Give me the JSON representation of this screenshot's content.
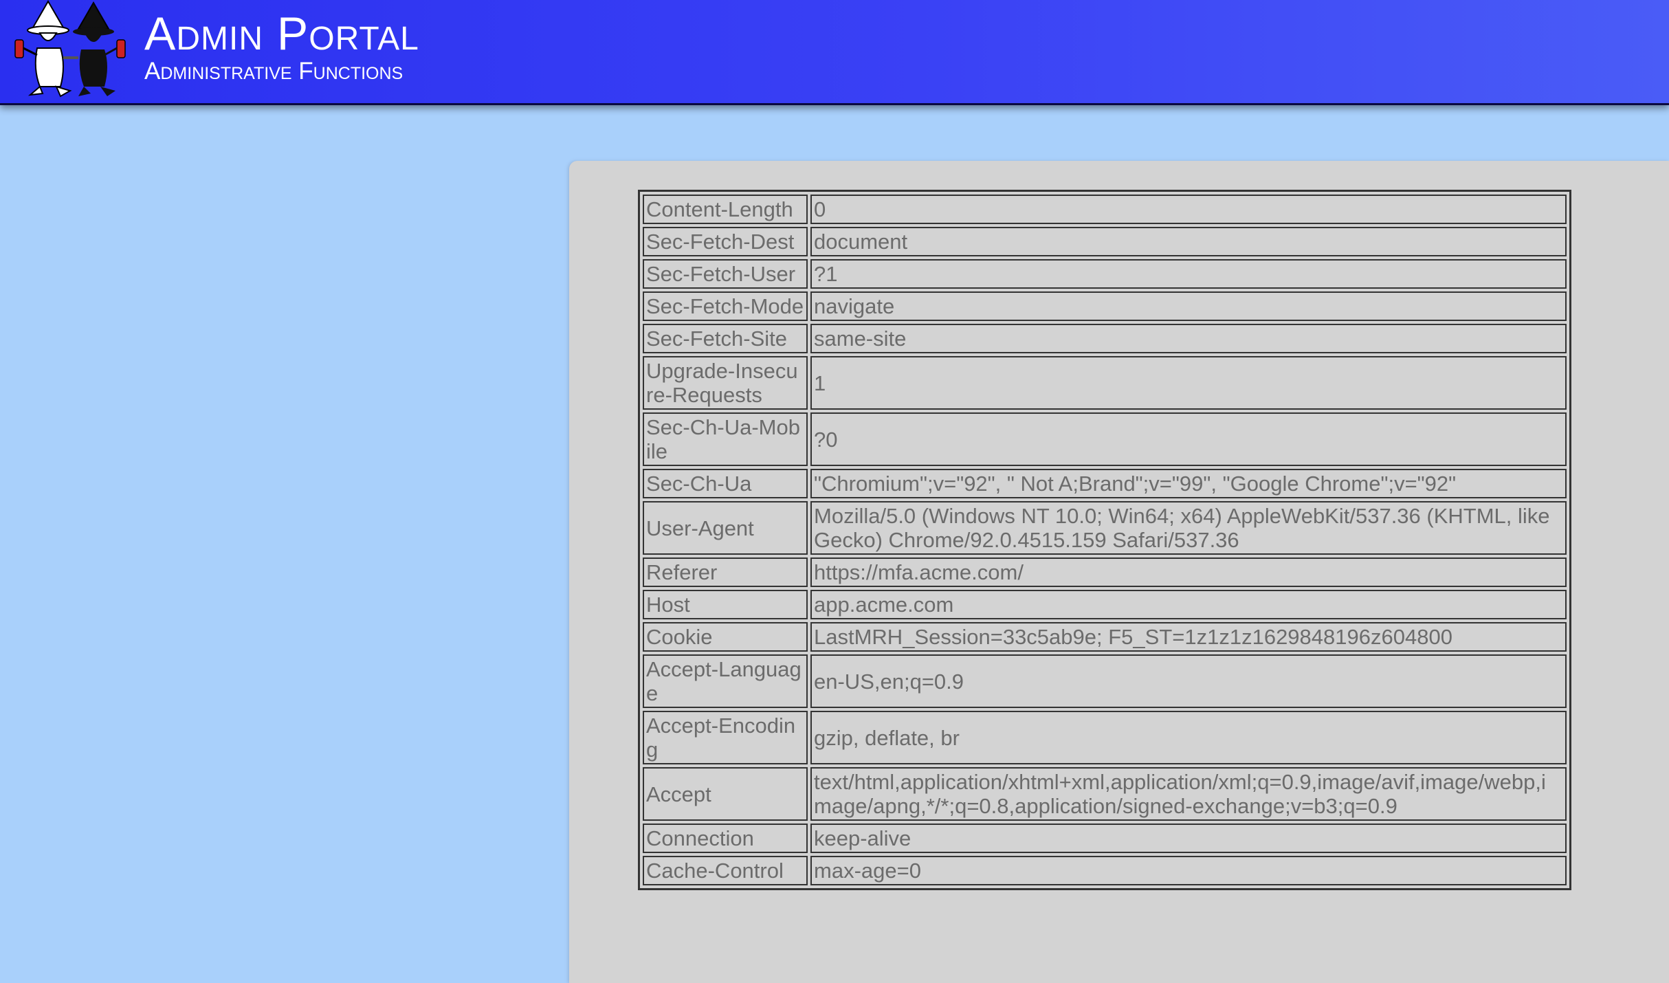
{
  "header": {
    "title": "Admin Portal",
    "subtitle": "Administrative Functions",
    "logo_icon": "spy-vs-spy-logo",
    "background_color": "#3439f3"
  },
  "headers_table": {
    "rows": [
      {
        "name": "Content-Length",
        "value": "0"
      },
      {
        "name": "Sec-Fetch-Dest",
        "value": "document"
      },
      {
        "name": "Sec-Fetch-User",
        "value": "?1"
      },
      {
        "name": "Sec-Fetch-Mode",
        "value": "navigate"
      },
      {
        "name": "Sec-Fetch-Site",
        "value": "same-site"
      },
      {
        "name": "Upgrade-Insecure-Requests",
        "value": "1"
      },
      {
        "name": "Sec-Ch-Ua-Mobile",
        "value": "?0"
      },
      {
        "name": "Sec-Ch-Ua",
        "value": "\"Chromium\";v=\"92\", \" Not A;Brand\";v=\"99\", \"Google Chrome\";v=\"92\""
      },
      {
        "name": "User-Agent",
        "value": "Mozilla/5.0 (Windows NT 10.0; Win64; x64) AppleWebKit/537.36 (KHTML, like Gecko) Chrome/92.0.4515.159 Safari/537.36"
      },
      {
        "name": "Referer",
        "value": "https://mfa.acme.com/"
      },
      {
        "name": "Host",
        "value": "app.acme.com"
      },
      {
        "name": "Cookie",
        "value": "LastMRH_Session=33c5ab9e; F5_ST=1z1z1z1629848196z604800"
      },
      {
        "name": "Accept-Language",
        "value": "en-US,en;q=0.9"
      },
      {
        "name": "Accept-Encoding",
        "value": "gzip, deflate, br"
      },
      {
        "name": "Accept",
        "value": "text/html,application/xhtml+xml,application/xml;q=0.9,image/avif,image/webp,image/apng,*/*;q=0.8,application/signed-exchange;v=b3;q=0.9"
      },
      {
        "name": "Connection",
        "value": "keep-alive"
      },
      {
        "name": "Cache-Control",
        "value": "max-age=0"
      }
    ]
  },
  "colors": {
    "page_background": "#a9d0fb",
    "panel_background": "#d3d3d3",
    "cell_text": "#6b6b6b"
  }
}
